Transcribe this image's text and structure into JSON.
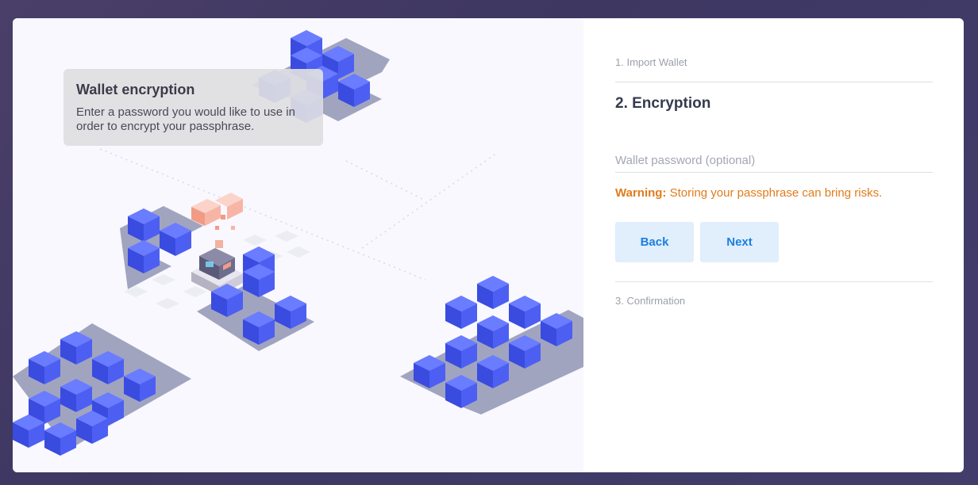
{
  "colors": {
    "background": "#433d6c",
    "accent_blue": "#4b5ff0",
    "button_bg": "#e1eefc",
    "button_text": "#1a7fe0",
    "warning": "#e07c1c"
  },
  "tooltip": {
    "title": "Wallet encryption",
    "text": "Enter a password you would like to use in order to encrypt your passphrase."
  },
  "steps": {
    "step1": "1. Import Wallet",
    "step2": "2. Encryption",
    "step3": "3. Confirmation"
  },
  "form": {
    "password_placeholder": "Wallet password (optional)",
    "password_value": "",
    "warning_label": "Warning:",
    "warning_text": " Storing your passphrase can bring risks.",
    "back_label": "Back",
    "next_label": "Next"
  },
  "illustration": {
    "name": "isometric-blocks-illustration"
  }
}
